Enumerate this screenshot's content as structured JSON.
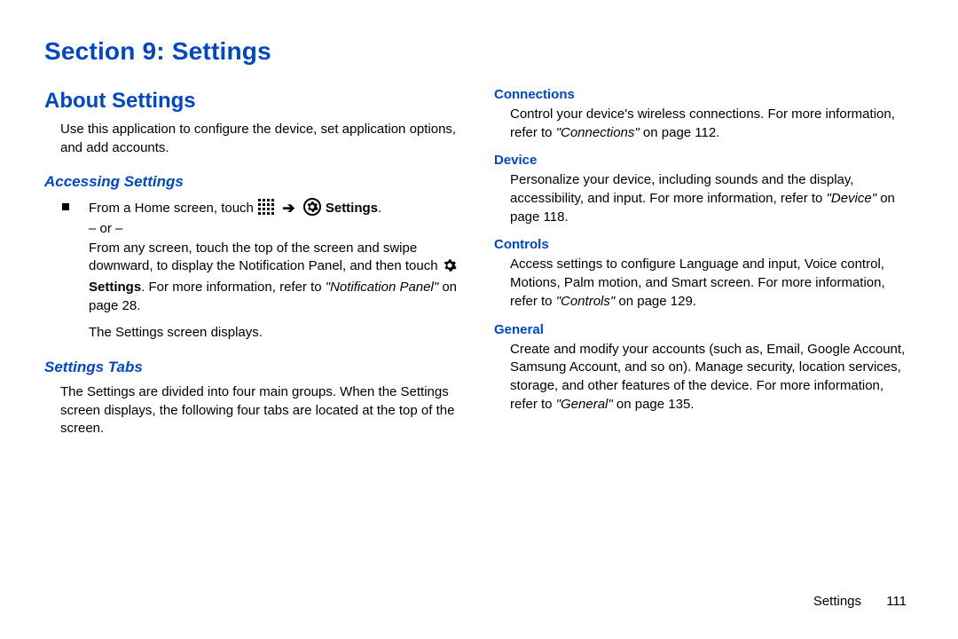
{
  "section_title": "Section 9: Settings",
  "left": {
    "about_heading": "About Settings",
    "about_body": "Use this application to configure the device, set application options, and add accounts.",
    "accessing_heading": "Accessing Settings",
    "step_prefix": "From a Home screen, touch ",
    "step_settings_label": "Settings",
    "step_suffix": ".",
    "or_text": "– or –",
    "swipe_a": "From any screen, touch the top of the screen and swipe downward, to display the Notification Panel, and then touch ",
    "swipe_settings_label": "Settings",
    "swipe_b": ". For more information, refer to ",
    "swipe_ref_ital": "\"Notification Panel\"",
    "swipe_ref_tail": " on page 28.",
    "result_line": "The Settings screen displays.",
    "tabs_heading": "Settings Tabs",
    "tabs_body": "The Settings are divided into four main groups. When the Settings screen displays, the following four tabs are located at the top of the screen."
  },
  "right": {
    "connections_h": "Connections",
    "connections_a": "Control your device's wireless connections. For more information, refer to ",
    "connections_ital": "\"Connections\"",
    "connections_tail": " on page 112.",
    "device_h": "Device",
    "device_a": "Personalize your device, including sounds and the display, accessibility, and input. For more information, refer to ",
    "device_ital": "\"Device\"",
    "device_tail": " on page 118.",
    "controls_h": "Controls",
    "controls_a": "Access settings to configure Language and input, Voice control, Motions, Palm motion, and Smart screen. For more information, refer to ",
    "controls_ital": "\"Controls\"",
    "controls_tail": " on page 129.",
    "general_h": "General",
    "general_a": "Create and modify your accounts (such as, Email, Google Account, Samsung Account, and so on). Manage security, location services, storage, and other features of the device. For more information, refer to ",
    "general_ital": "\"General\"",
    "general_tail": " on page 135."
  },
  "footer": {
    "label": "Settings",
    "page": "111"
  }
}
